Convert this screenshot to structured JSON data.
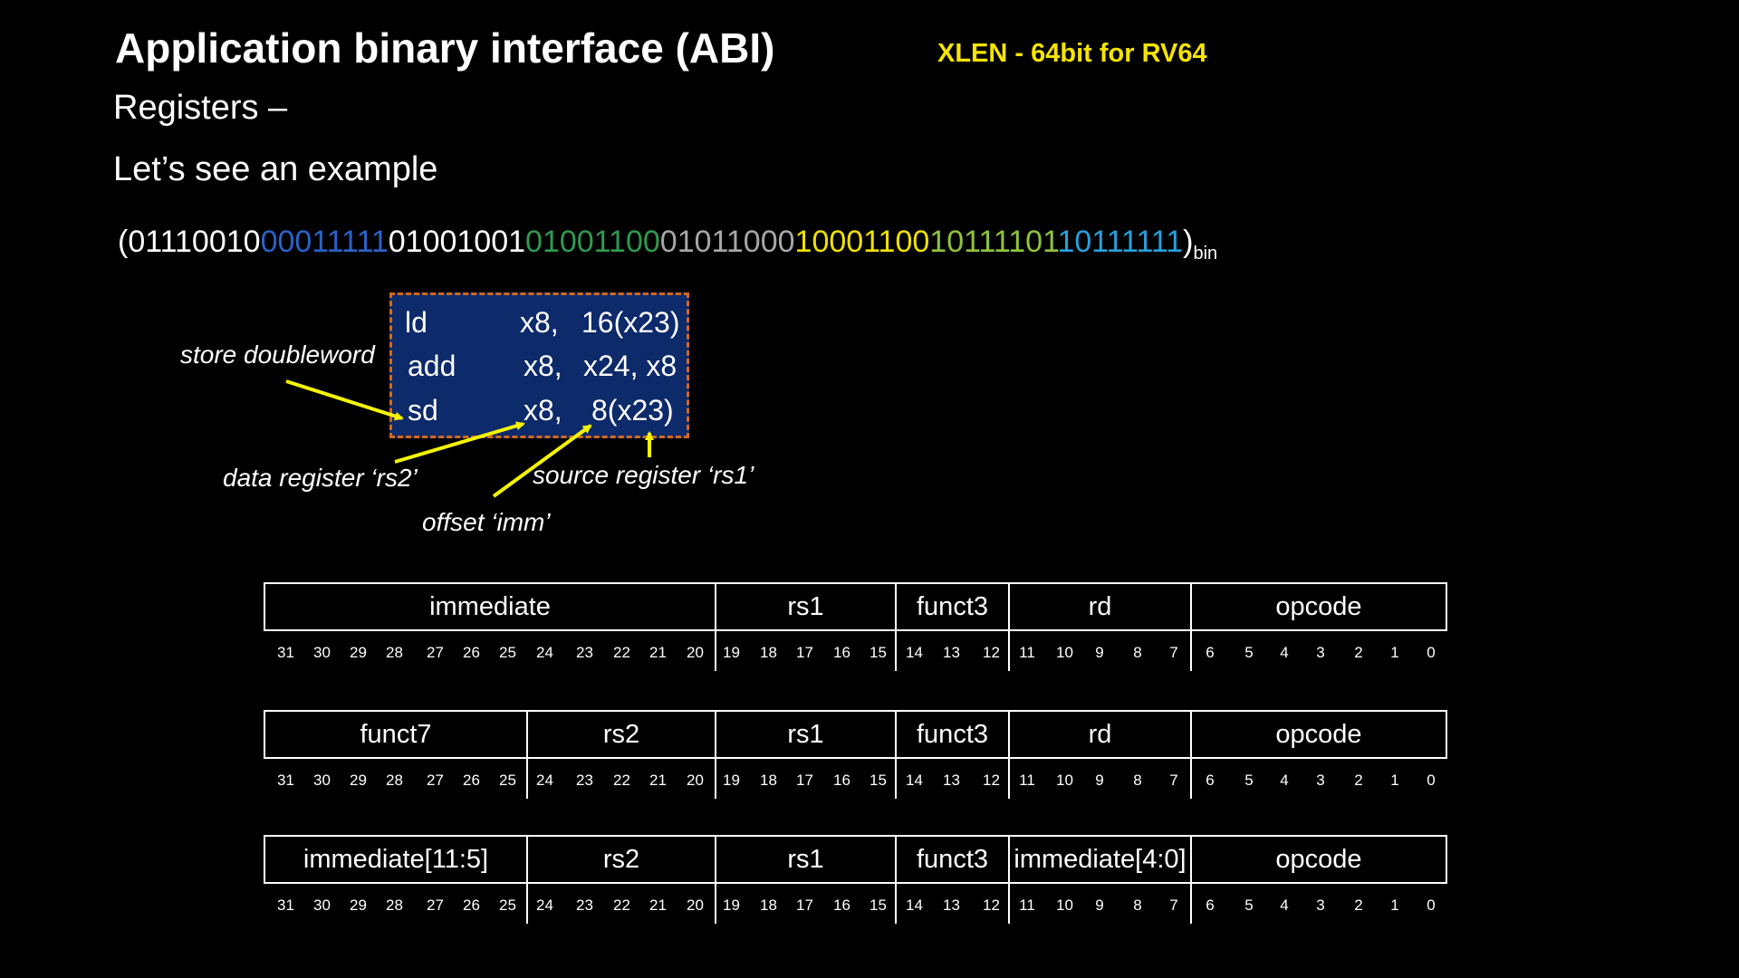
{
  "title": "Application binary interface (ABI)",
  "xlen_note": {
    "text": "XLEN - 64bit for RV64",
    "color": "#f5e400"
  },
  "subtitle": "Registers –",
  "subtitle2": "Let’s see an example",
  "binary": {
    "open": "(",
    "segments": [
      {
        "text": "01110010",
        "color": "#ffffff"
      },
      {
        "text": "00011111",
        "color": "#2962c9"
      },
      {
        "text": "01001001",
        "color": "#ffffff"
      },
      {
        "text": "01001100",
        "color": "#2e9a50"
      },
      {
        "text": "01011000",
        "color": "#a6a6a6"
      },
      {
        "text": "10001100",
        "color": "#f0e000"
      },
      {
        "text": "10111101",
        "color": "#8fc43d"
      },
      {
        "text": "10111111",
        "color": "#27a0dc"
      }
    ],
    "close": ")",
    "subscript": "bin"
  },
  "code": [
    {
      "op": "ld",
      "a": "x8,",
      "b": "16(x23)"
    },
    {
      "op": "add",
      "a": "x8,",
      "b": "x24, x8"
    },
    {
      "op": "sd",
      "a": "x8,",
      "b": "8(x23)"
    }
  ],
  "annotations": {
    "store": "store doubleword",
    "rs2": "data register ‘rs2’",
    "imm": "offset ‘imm’",
    "rs1": "source register ‘rs1’",
    "arrow_color": "#f5f500"
  },
  "formats": [
    {
      "fields": [
        "immediate",
        "rs1",
        "funct3",
        "rd",
        "opcode"
      ]
    },
    {
      "fields": [
        "funct7",
        "rs2",
        "rs1",
        "funct3",
        "rd",
        "opcode"
      ]
    },
    {
      "fields": [
        "immediate[11:5]",
        "rs2",
        "rs1",
        "funct3",
        "immediate[4:0]",
        "opcode"
      ]
    }
  ],
  "bit_labels": [
    "31",
    "30",
    "29",
    "28",
    "27",
    "26",
    "25",
    "24",
    "23",
    "22",
    "21",
    "20",
    "19",
    "18",
    "17",
    "16",
    "15",
    "14",
    "13",
    "12",
    "11",
    "10",
    "9",
    "8",
    "7",
    "6",
    "5",
    "4",
    "3",
    "2",
    "1",
    "0"
  ]
}
